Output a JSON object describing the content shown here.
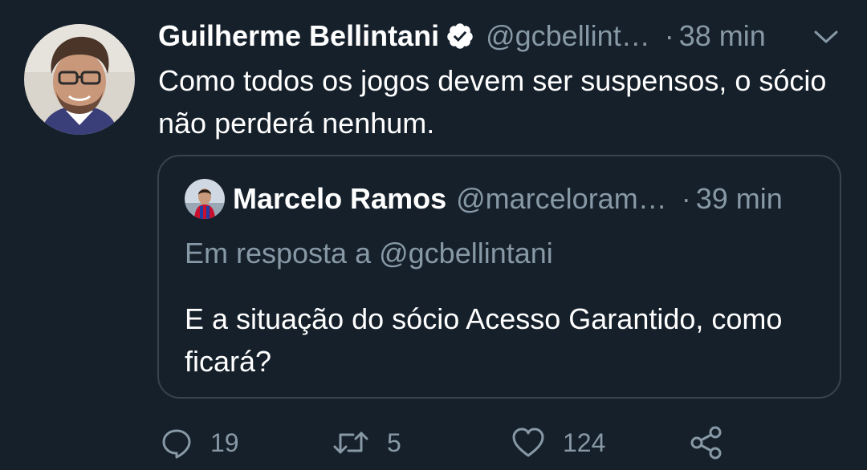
{
  "tweet": {
    "author_name": "Guilherme Bellintani",
    "handle": "@gcbellint…",
    "separator": "·",
    "time": "38 min",
    "text": "Como todos os jogos devem ser suspensos, o sócio não perderá nenhum.",
    "verified_icon": "verified-badge-icon",
    "menu_icon": "chevron-down-icon"
  },
  "quoted_tweet": {
    "author_name": "Marcelo Ramos",
    "handle": "@marceloram…",
    "separator": "·",
    "time": "39 min",
    "reply_to": "Em resposta a @gcbellintani",
    "text": "E a situação do sócio Acesso Garantido, como ficará?"
  },
  "actions": {
    "reply_count": "19",
    "retweet_count": "5",
    "like_count": "124",
    "reply_icon": "reply-icon",
    "retweet_icon": "retweet-icon",
    "like_icon": "heart-icon",
    "share_icon": "share-icon"
  },
  "colors": {
    "background": "#15202b",
    "primary_text": "#ffffff",
    "secondary_text": "#8899a6",
    "border": "#38444d"
  }
}
